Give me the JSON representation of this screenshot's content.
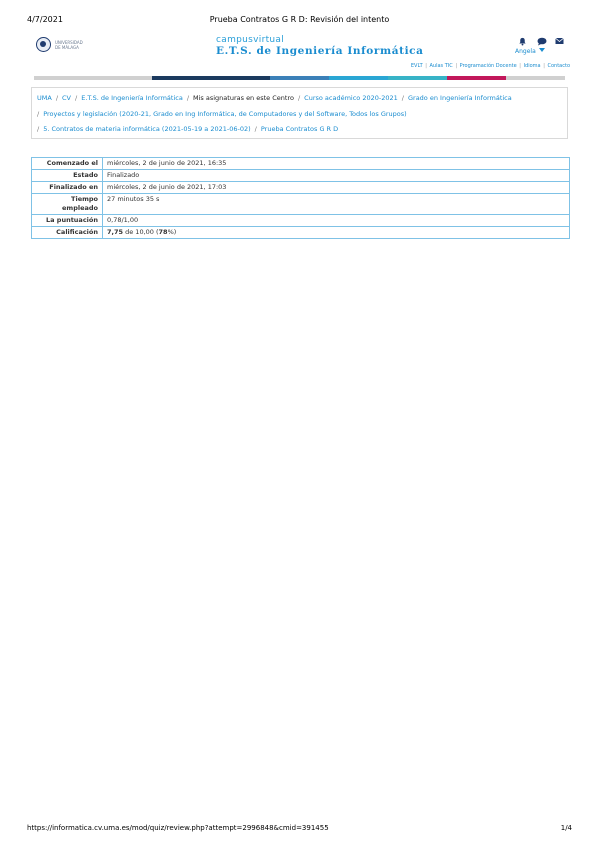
{
  "print_header": {
    "date": "4/7/2021",
    "title": "Prueba Contratos G R D: Revisión del intento"
  },
  "logo": {
    "text_line1": "UNIVERSIDAD",
    "text_line2": "DE MÁLAGA"
  },
  "site": {
    "line1": "campusvirtual",
    "line2": "E.T.S. de Ingeniería Informática"
  },
  "header_icons": [
    "bell-icon",
    "chat-icon",
    "mail-icon"
  ],
  "user": {
    "name": "Angela"
  },
  "top_links": [
    "EVLT",
    "Aulas TIC",
    "Programación Docente",
    "Idioma",
    "Contacto"
  ],
  "color_bar": [
    "#d0d0d0",
    "#d0d0d0",
    "#1b3a5f",
    "#1b3a5f",
    "#3b80b8",
    "#2aa6d4",
    "#37b3c7",
    "#c2185b",
    "#d0d0d0"
  ],
  "breadcrumb": {
    "line1": [
      "UMA",
      "CV",
      "E.T.S. de Ingeniería Informática",
      "Mis asignaturas en este Centro",
      "Curso académico 2020-2021",
      "Grado en Ingeniería Informática"
    ],
    "line2": [
      "Proyectos y legislación (2020-21, Grado en Ing Informática, de Computadores y del Software, Todos los Grupos)"
    ],
    "line3": [
      "5. Contratos de materia informática (2021-05-19 a 2021-06-02)",
      "Prueba Contratos G R D"
    ]
  },
  "summary": {
    "comenzado_label": "Comenzado el",
    "comenzado_value": "miércoles, 2 de junio de 2021, 16:35",
    "estado_label": "Estado",
    "estado_value": "Finalizado",
    "finalizado_label": "Finalizado en",
    "finalizado_value": "miércoles, 2 de junio de 2021, 17:03",
    "tiempo_label_1": "Tiempo",
    "tiempo_label_2": "empleado",
    "tiempo_value": "27 minutos 35 s",
    "puntuacion_label": "La puntuación",
    "puntuacion_value": "0,78/1,00",
    "calificacion_label": "Calificación",
    "calificacion_score": "7,75",
    "calificacion_mid": " de 10,00 (",
    "calificacion_pct": "78",
    "calificacion_end": "%)"
  },
  "print_footer": {
    "url": "https://informatica.cv.uma.es/mod/quiz/review.php?attempt=2996848&cmid=391455",
    "page": "1/4"
  }
}
